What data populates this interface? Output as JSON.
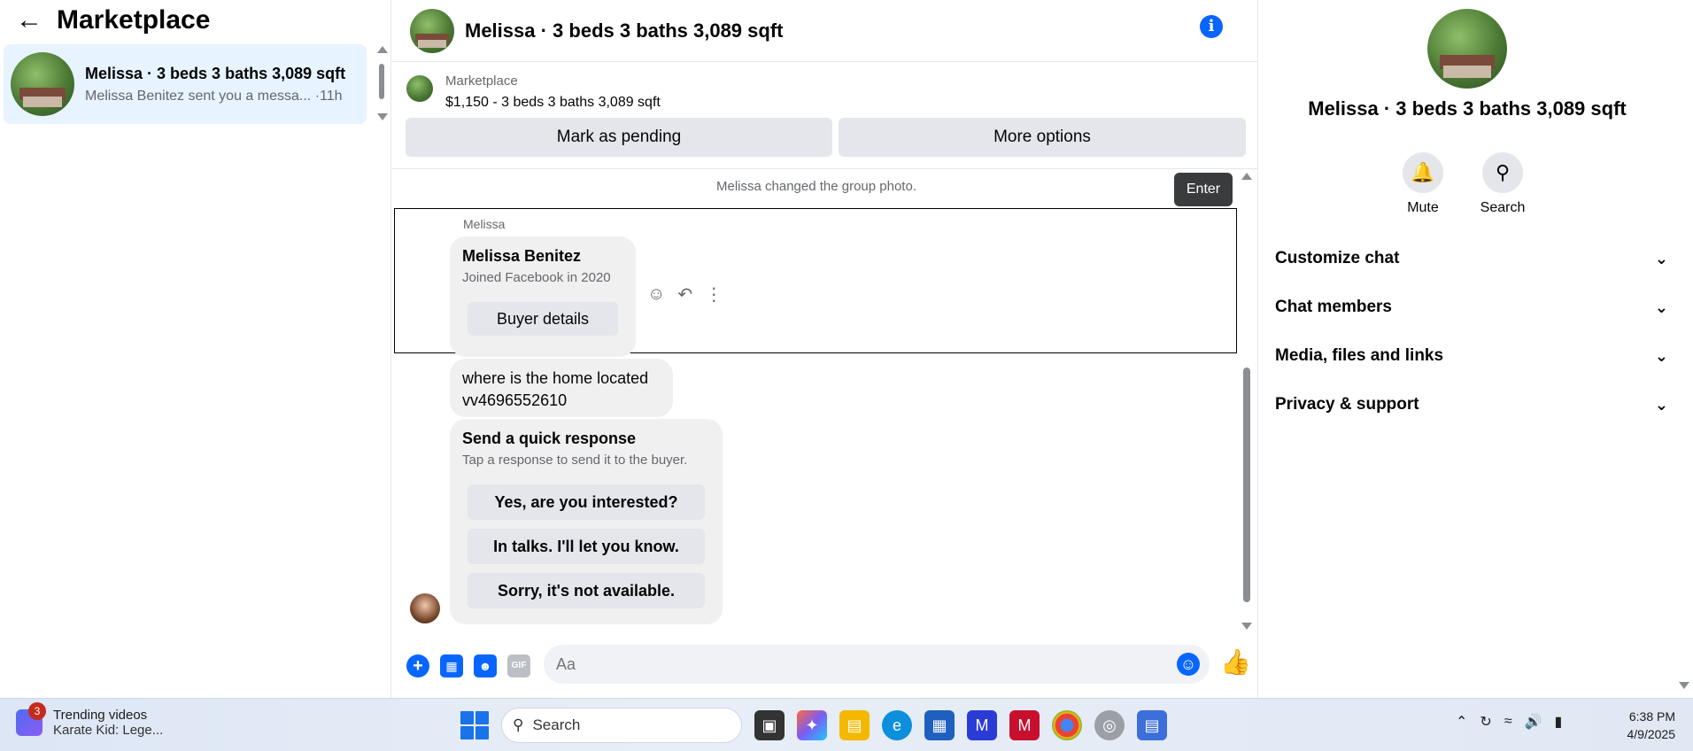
{
  "left": {
    "title": "Marketplace",
    "conversation": {
      "name": "Melissa · 3 beds 3 baths 3,089 sqft",
      "preview": "Melissa Benitez sent you a messa...",
      "time": "·11h"
    }
  },
  "header": {
    "title": "Melissa · 3 beds 3 baths 3,089 sqft"
  },
  "listing": {
    "source": "Marketplace",
    "price_line": "$1,150 - 3 beds 3 baths 3,089 sqft",
    "mark_pending_label": "Mark as pending",
    "more_options_label": "More options"
  },
  "messages": {
    "system_note": "Melissa changed the group photo.",
    "tooltip": "Enter",
    "sender_label": "Melissa",
    "card": {
      "name": "Melissa Benitez",
      "joined": "Joined Facebook in 2020",
      "button": "Buyer details"
    },
    "text_message_line1": "where is the home located",
    "text_message_line2": "vv4696552610",
    "quick": {
      "title": "Send a quick response",
      "subtitle": "Tap a response to send it to the buyer.",
      "options": [
        "Yes, are you interested?",
        "In talks. I'll let you know.",
        "Sorry, it's not available."
      ]
    }
  },
  "composer": {
    "placeholder": "Aa",
    "gif_label": "GIF"
  },
  "right": {
    "title": "Melissa · 3 beds 3 baths 3,089 sqft",
    "mute_label": "Mute",
    "search_label": "Search",
    "sections": [
      "Customize chat",
      "Chat members",
      "Media, files and links",
      "Privacy & support"
    ]
  },
  "taskbar": {
    "news_badge": "3",
    "news_title": "Trending videos",
    "news_sub": "Karate Kid: Lege...",
    "search_label": "Search",
    "time": "6:38 PM",
    "date": "4/9/2025"
  },
  "colors": {
    "accent": "#0866ff",
    "selected_bg": "#e7f3ff",
    "button_bg": "#e4e6eb",
    "bubble_bg": "#f0f0f0"
  }
}
